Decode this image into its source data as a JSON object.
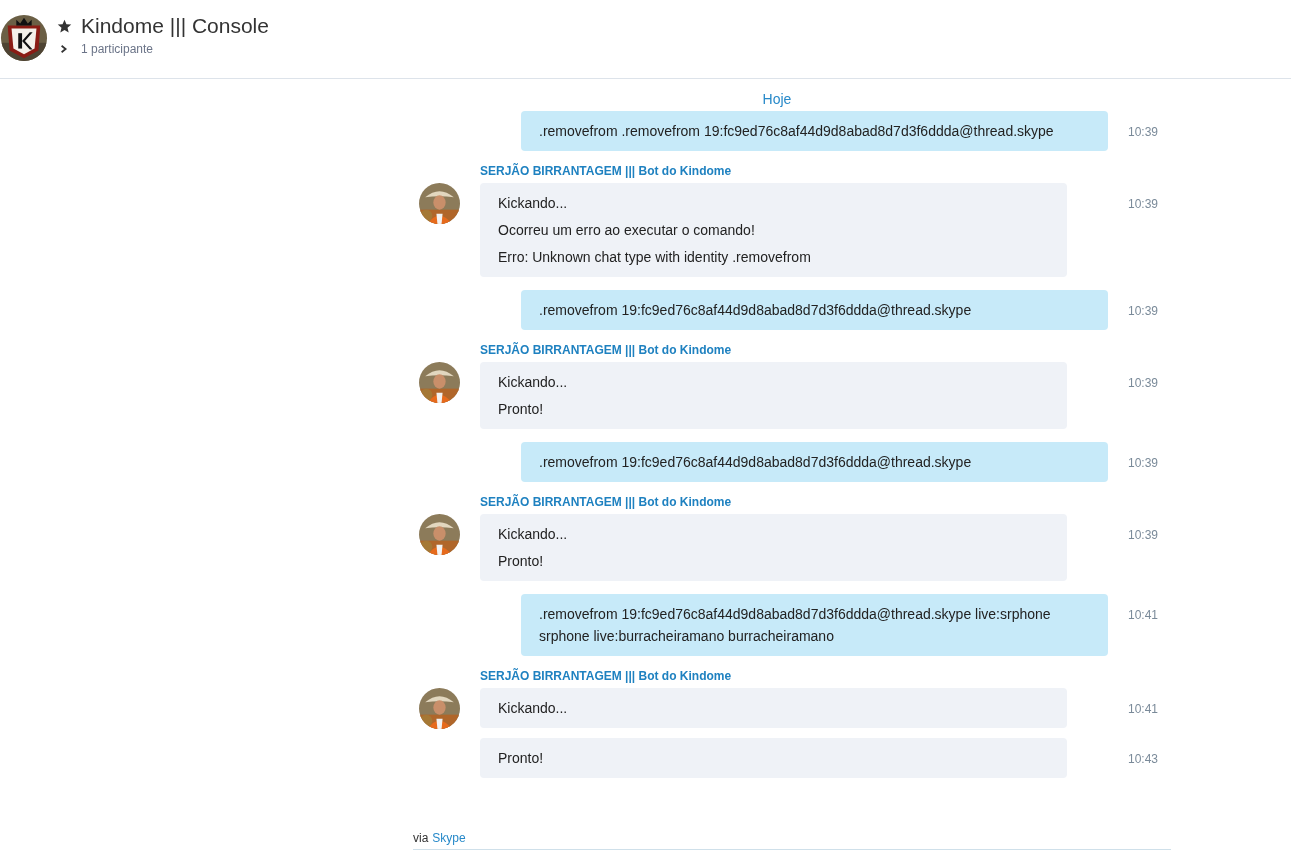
{
  "header": {
    "title": "Kindome ||| Console",
    "participants": "1 participante"
  },
  "date_divider": "Hoje",
  "messages": [
    {
      "kind": "outgoing",
      "lines": [
        ".removefrom .removefrom 19:fc9ed76c8af44d9d8abad8d7d3f6ddda@thread.skype"
      ],
      "time": "10:39"
    },
    {
      "kind": "incoming",
      "sender": "SERJÃO BIRRANTAGEM ||| Bot do Kindome",
      "bubbles": [
        {
          "lines": [
            "Kickando...",
            "Ocorreu um erro ao executar o comando!",
            "Erro: Unknown chat type with identity .removefrom"
          ],
          "time": "10:39"
        }
      ]
    },
    {
      "kind": "outgoing",
      "lines": [
        ".removefrom 19:fc9ed76c8af44d9d8abad8d7d3f6ddda@thread.skype"
      ],
      "time": "10:39"
    },
    {
      "kind": "incoming",
      "sender": "SERJÃO BIRRANTAGEM ||| Bot do Kindome",
      "bubbles": [
        {
          "lines": [
            "Kickando...",
            "Pronto!"
          ],
          "time": "10:39"
        }
      ]
    },
    {
      "kind": "outgoing",
      "lines": [
        ".removefrom 19:fc9ed76c8af44d9d8abad8d7d3f6ddda@thread.skype"
      ],
      "time": "10:39"
    },
    {
      "kind": "incoming",
      "sender": "SERJÃO BIRRANTAGEM ||| Bot do Kindome",
      "bubbles": [
        {
          "lines": [
            "Kickando...",
            "Pronto!"
          ],
          "time": "10:39"
        }
      ]
    },
    {
      "kind": "outgoing",
      "lines": [
        ".removefrom 19:fc9ed76c8af44d9d8abad8d7d3f6ddda@thread.skype live:srphone srphone live:burracheiramano burracheiramano"
      ],
      "time": "10:41"
    },
    {
      "kind": "incoming",
      "sender": "SERJÃO BIRRANTAGEM ||| Bot do Kindome",
      "bubbles": [
        {
          "lines": [
            "Kickando..."
          ],
          "time": "10:41"
        },
        {
          "lines": [
            "Pronto!"
          ],
          "time": "10:43"
        }
      ]
    }
  ],
  "footer": {
    "via": "via",
    "link": "Skype"
  }
}
